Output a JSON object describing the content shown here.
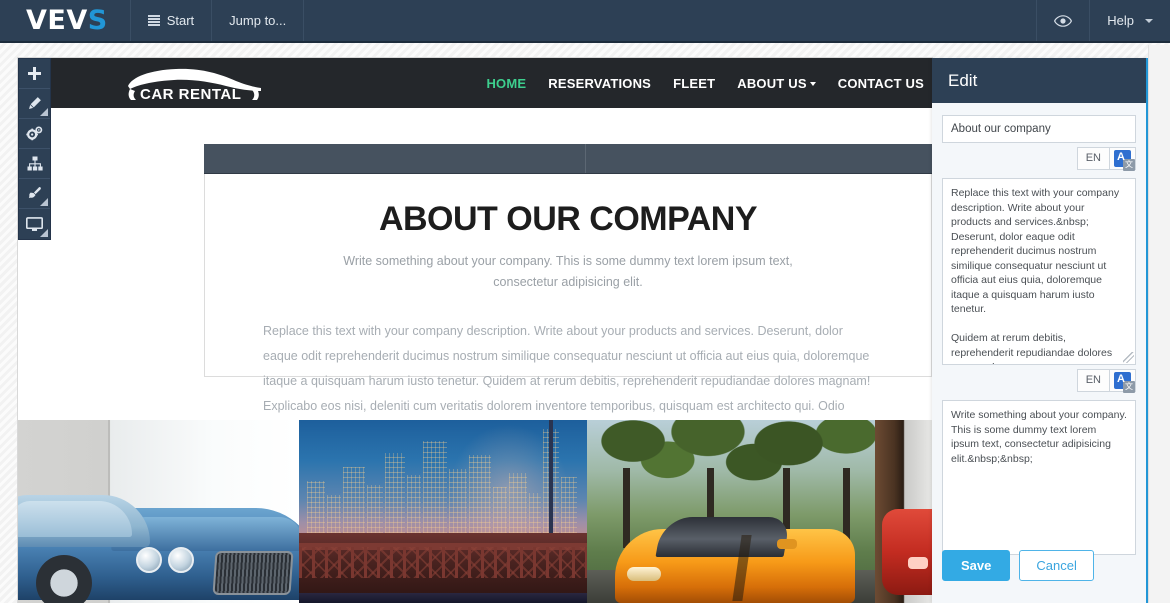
{
  "topbar": {
    "logo_main": "VEV",
    "logo_accent": "S",
    "start_label": "Start",
    "jump_label": "Jump to...",
    "preview_icon": "eye-icon",
    "help_label": "Help"
  },
  "rail": {
    "items": [
      {
        "name": "add-element-button",
        "icon": "plus-icon"
      },
      {
        "name": "edit-content-button",
        "icon": "pencil-icon"
      },
      {
        "name": "settings-button",
        "icon": "gears-icon"
      },
      {
        "name": "site-structure-button",
        "icon": "sitemap-icon"
      },
      {
        "name": "design-button",
        "icon": "paintbrush-icon"
      },
      {
        "name": "preview-device-button",
        "icon": "monitor-icon"
      }
    ]
  },
  "site": {
    "logo_text": "CAR RENTAL",
    "nav": [
      {
        "label": "HOME",
        "active": true,
        "has_caret": false
      },
      {
        "label": "RESERVATIONS",
        "active": false,
        "has_caret": false
      },
      {
        "label": "FLEET",
        "active": false,
        "has_caret": false
      },
      {
        "label": "ABOUT US",
        "active": false,
        "has_caret": true
      },
      {
        "label": "CONTACT US",
        "active": false,
        "has_caret": false
      }
    ],
    "page": {
      "title": "ABOUT OUR COMPANY",
      "subtitle": "Write something about your company. This is some dummy text lorem ipsum text, consectetur adipisicing elit.",
      "paragraph": "Replace this text with your company description. Write about your products and services.  Deserunt, dolor eaque odit reprehenderit ducimus nostrum similique consequatur nesciunt ut officia aut eius quia, doloremque itaque a quisquam harum iusto tenetur. Quidem at rerum debitis, reprehenderit repudiandae dolores magnam!  Explicabo eos nisi, deleniti cum veritatis dolorem inventore temporibus, quisquam est architecto qui. Odio beatae fugiat ullam incidunt. Labore distinctio dolor corporis?"
    },
    "gallery": [
      {
        "name": "gallery-image-blue-car",
        "alt": "Blue luxury sedan by concrete wall"
      },
      {
        "name": "gallery-image-city-skyline",
        "alt": "City skyline at dusk behind bridge"
      },
      {
        "name": "gallery-image-orange-sportscar",
        "alt": "Orange sports car on tree-lined road"
      },
      {
        "name": "gallery-image-red-car",
        "alt": "Red car partial view"
      }
    ]
  },
  "edit_panel": {
    "header": "Edit",
    "title_field": {
      "value": "About our company",
      "placeholder": "About our company"
    },
    "lang_button": "EN",
    "translate_icon": "google-translate-icon",
    "body_textarea": {
      "value": "Replace this text with your company description. Write about your products and services.&nbsp; Deserunt, dolor eaque odit reprehenderit ducimus nostrum similique consequatur nesciunt ut officia aut eius quia, doloremque itaque a quisquam harum iusto tenetur.\n\nQuidem at rerum debitis, reprehenderit repudiandae dolores magnam!\n\n&nbsp;Explicabo eos nisi, deleniti cum veritatis dolorem inventore temporibus, quisquam est architecto qui. Odio beatae fugiat ullam incidunt. Labore distinctio dolor corporis?"
    },
    "sub_textarea": {
      "value": "Write something about your company. This is some dummy text lorem ipsum text, consectetur adipisicing elit.&nbsp;&nbsp;"
    },
    "save_label": "Save",
    "cancel_label": "Cancel"
  },
  "colors": {
    "topbar_bg": "#2d4055",
    "accent_blue": "#2196d6",
    "save_blue": "#33aae4",
    "nav_active_green": "#3dcf8e",
    "site_header_bg": "#24272b",
    "slate_strip": "#46525f"
  }
}
